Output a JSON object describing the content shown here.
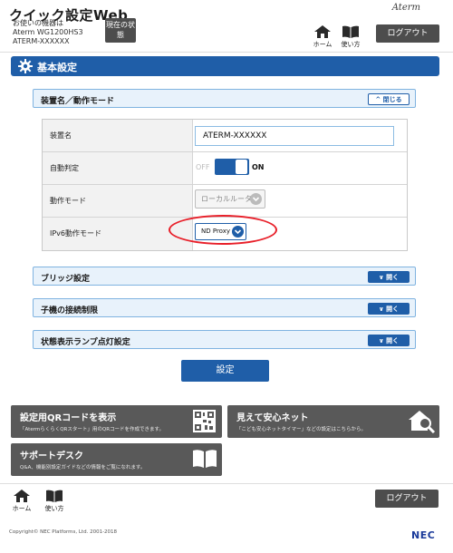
{
  "header": {
    "title": "クイック設定Web",
    "device_caption": "お使いの機器は",
    "device_model": "Aterm WG1200HS3",
    "device_name": "ATERM-XXXXXX",
    "status_button": "現在の状態",
    "brand": "Aterm",
    "home_label": "ホーム",
    "help_label": "使い方",
    "logout_label": "ログアウト"
  },
  "section": {
    "title": "基本設定"
  },
  "panel_device": {
    "title": "装置名／動作モード",
    "toggle_label": "閉じる",
    "rows": {
      "device_name_label": "装置名",
      "device_name_value": "ATERM-XXXXXX",
      "auto_detect_label": "自動判定",
      "auto_detect_off": "OFF",
      "auto_detect_on": "ON",
      "mode_label": "動作モード",
      "mode_value": "ローカルルータ",
      "ipv6_label": "IPv6動作モード",
      "ipv6_value": "ND Proxy"
    }
  },
  "collapsed_panels": [
    {
      "title": "ブリッジ設定",
      "toggle_label": "開く"
    },
    {
      "title": "子機の接続制限",
      "toggle_label": "開く"
    },
    {
      "title": "状態表示ランプ点灯設定",
      "toggle_label": "開く"
    }
  ],
  "apply_label": "設定",
  "cards": {
    "qr_title": "設定用QRコードを表示",
    "qr_desc": "「AtermらくらくQRスタート」用のQRコードを作成できます。",
    "safe_title": "見えて安心ネット",
    "safe_desc": "「こども安心ネットタイマー」などの設定はこちらから。",
    "support_title": "サポートデスク",
    "support_desc": "Q&A、機能別設定ガイドなどの情報をご覧になれます。"
  },
  "footer": {
    "home_label": "ホーム",
    "help_label": "使い方",
    "logout_label": "ログアウト",
    "copyright": "Copyright© NEC Platforms, Ltd. 2001-2018",
    "nec": "NEC"
  },
  "colors": {
    "primary_blue": "#1f5ea8",
    "panel_bg": "#e8f2fb",
    "dark_button": "#4d4d4d",
    "card_bg": "#595959",
    "highlight_red": "#e8202a"
  },
  "icons": [
    "home-icon",
    "book-icon",
    "gear-icon",
    "chevron-down-icon",
    "chevron-up-icon",
    "qr-code-icon",
    "house-search-icon"
  ]
}
